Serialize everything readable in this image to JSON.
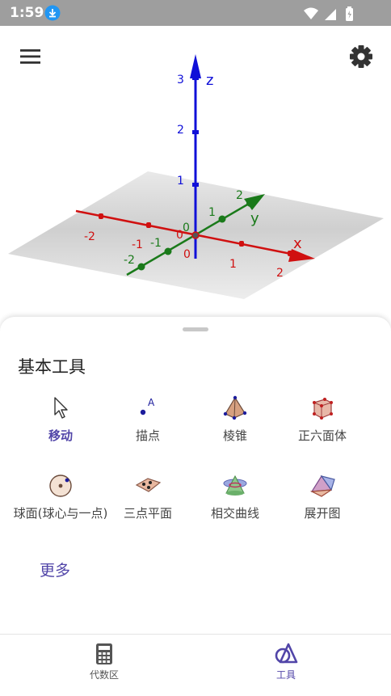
{
  "status_bar": {
    "time": "1:59"
  },
  "graph": {
    "z_label": "z",
    "x_label": "x",
    "y_label": "y",
    "z_ticks": [
      "3",
      "2",
      "1"
    ],
    "x_ticks": [
      "-2",
      "-1",
      "0",
      "1",
      "2"
    ],
    "y_ticks": [
      "-2",
      "-1",
      "0",
      "1",
      "2"
    ],
    "origin_label": "0"
  },
  "sheet": {
    "title": "基本工具",
    "tools": [
      {
        "label": "移动"
      },
      {
        "label": "描点"
      },
      {
        "label": "棱锥"
      },
      {
        "label": "正六面体"
      },
      {
        "label": "球面(球心与一点)"
      },
      {
        "label": "三点平面"
      },
      {
        "label": "相交曲线"
      },
      {
        "label": "展开图"
      }
    ],
    "more_label": "更多"
  },
  "bottom_nav": {
    "items": [
      {
        "label": "代数区"
      },
      {
        "label": "工具"
      }
    ]
  },
  "colors": {
    "accent": "#5145a8",
    "x_axis": "#d01010",
    "y_axis": "#1a7a1a",
    "z_axis": "#1010d8"
  }
}
